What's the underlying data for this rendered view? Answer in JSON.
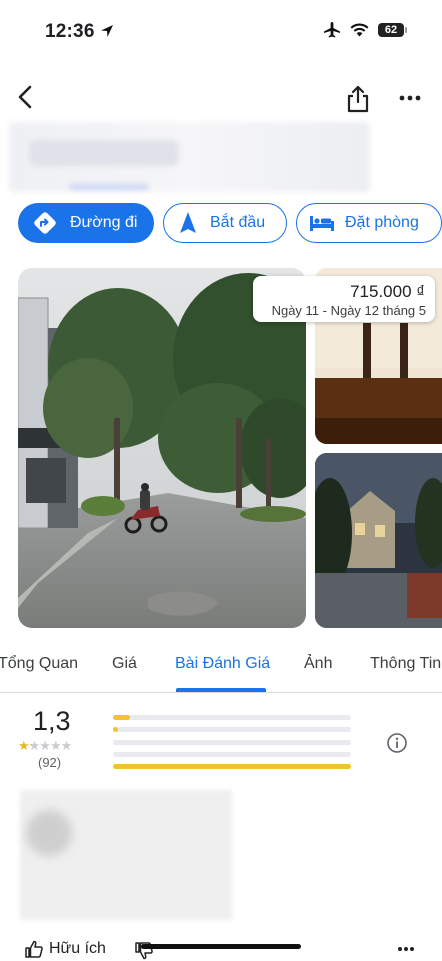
{
  "status": {
    "time": "12:36",
    "battery": "62"
  },
  "nav": {
    "back": "back",
    "share": "share",
    "more": "more"
  },
  "actions": [
    {
      "label": "Đường đi",
      "icon": "directions-icon"
    },
    {
      "label": "Bắt đầu",
      "icon": "navigation-arrow-icon"
    },
    {
      "label": "Đặt phòng",
      "icon": "bed-icon"
    }
  ],
  "price": {
    "amount": "715.000 ₫",
    "dates": "Ngày 11 - Ngày 12 tháng 5"
  },
  "tabs": [
    "Tổng Quan",
    "Giá",
    "Bài Đánh Giá",
    "Ảnh",
    "Thông Tin"
  ],
  "active_tab": "Bài Đánh Giá",
  "rating": {
    "value": "1,3",
    "count": "(92)",
    "stars": 1.3,
    "distribution": [
      {
        "stars": 5,
        "fraction": 0.07
      },
      {
        "stars": 4,
        "fraction": 0.02
      },
      {
        "stars": 3,
        "fraction": 0.0
      },
      {
        "stars": 2,
        "fraction": 0.0
      },
      {
        "stars": 1,
        "fraction": 1.0
      }
    ]
  },
  "review": {
    "helpful_label": "Hữu ích"
  },
  "colors": {
    "accent": "#1a73e8",
    "star": "#f1c232"
  }
}
